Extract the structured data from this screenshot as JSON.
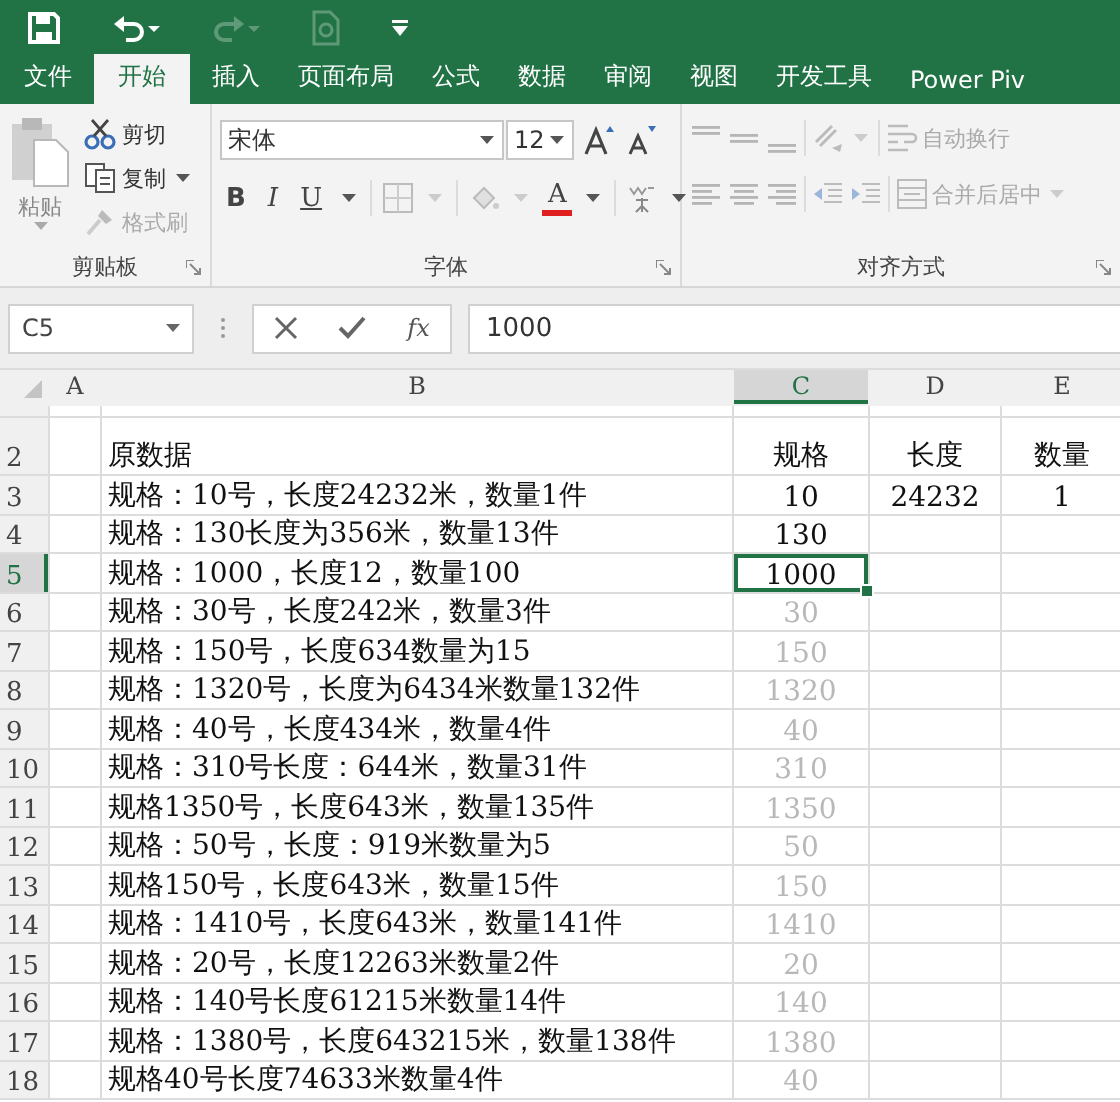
{
  "quick_access": [
    {
      "kind": "save",
      "disabled": false
    },
    {
      "kind": "undo",
      "disabled": false
    },
    {
      "kind": "redo",
      "disabled": true
    },
    {
      "kind": "preview",
      "disabled": true
    },
    {
      "kind": "customize",
      "disabled": false
    }
  ],
  "tabs": [
    {
      "label": "文件",
      "selected": false
    },
    {
      "label": "开始",
      "selected": true
    },
    {
      "label": "插入",
      "selected": false
    },
    {
      "label": "页面布局",
      "selected": false
    },
    {
      "label": "公式",
      "selected": false
    },
    {
      "label": "数据",
      "selected": false
    },
    {
      "label": "审阅",
      "selected": false
    },
    {
      "label": "视图",
      "selected": false
    },
    {
      "label": "开发工具",
      "selected": false
    },
    {
      "label": "Power Piv",
      "selected": false
    }
  ],
  "clipboard": {
    "label": "剪贴板",
    "paste": "粘贴",
    "cut": "剪切",
    "copy": "复制",
    "format_painter": {
      "label": "格式刷",
      "disabled": true
    }
  },
  "font": {
    "label": "字体",
    "font_name": "宋体",
    "font_size": "12",
    "bold": "B",
    "italic": "I",
    "underline": "U",
    "font_color": "A"
  },
  "alignment": {
    "label": "对齐方式",
    "wrap_text": {
      "label": "自动换行",
      "disabled": true
    },
    "merge": {
      "label": "合并后居中",
      "disabled": true
    }
  },
  "formula_bar": {
    "name_box": "C5",
    "function_label": "fx",
    "value": "1000"
  },
  "sheet": {
    "columns": [
      {
        "label": "A",
        "selected": false
      },
      {
        "label": "B",
        "selected": false
      },
      {
        "label": "C",
        "selected": true
      },
      {
        "label": "D",
        "selected": false
      },
      {
        "label": "E",
        "selected": false
      }
    ],
    "rows": [
      {
        "header": "2",
        "selected": false,
        "b": "原数据",
        "c": {
          "text": "规格",
          "preview": false,
          "active": false
        },
        "d": "长度",
        "e": "数量"
      },
      {
        "header": "3",
        "selected": false,
        "b": "规格：10号，长度24232米，数量1件",
        "c": {
          "text": "10",
          "preview": false,
          "active": false
        },
        "d": "24232",
        "e": "1"
      },
      {
        "header": "4",
        "selected": false,
        "b": "规格：130长度为356米，数量13件",
        "c": {
          "text": "130",
          "preview": false,
          "active": false
        }
      },
      {
        "header": "5",
        "selected": true,
        "b": "规格：1000，长度12，数量100",
        "c": {
          "text": "1000",
          "preview": false,
          "active": true
        }
      },
      {
        "header": "6",
        "selected": false,
        "b": "规格：30号，长度242米，数量3件",
        "c": {
          "text": "30",
          "preview": true,
          "active": false
        }
      },
      {
        "header": "7",
        "selected": false,
        "b": "规格：150号，长度634数量为15",
        "c": {
          "text": "150",
          "preview": true,
          "active": false
        }
      },
      {
        "header": "8",
        "selected": false,
        "b": "规格：1320号，长度为6434米数量132件",
        "c": {
          "text": "1320",
          "preview": true,
          "active": false
        }
      },
      {
        "header": "9",
        "selected": false,
        "b": "规格：40号，长度434米，数量4件",
        "c": {
          "text": "40",
          "preview": true,
          "active": false
        }
      },
      {
        "header": "10",
        "selected": false,
        "b": "规格：310号长度：644米，数量31件",
        "c": {
          "text": "310",
          "preview": true,
          "active": false
        }
      },
      {
        "header": "11",
        "selected": false,
        "b": "规格1350号，长度643米，数量135件",
        "c": {
          "text": "1350",
          "preview": true,
          "active": false
        }
      },
      {
        "header": "12",
        "selected": false,
        "b": "规格：50号，长度：919米数量为5",
        "c": {
          "text": "50",
          "preview": true,
          "active": false
        }
      },
      {
        "header": "13",
        "selected": false,
        "b": "规格150号，长度643米，数量15件",
        "c": {
          "text": "150",
          "preview": true,
          "active": false
        }
      },
      {
        "header": "14",
        "selected": false,
        "b": "规格：1410号，长度643米，数量141件",
        "c": {
          "text": "1410",
          "preview": true,
          "active": false
        }
      },
      {
        "header": "15",
        "selected": false,
        "b": "规格：20号，长度12263米数量2件",
        "c": {
          "text": "20",
          "preview": true,
          "active": false
        }
      },
      {
        "header": "16",
        "selected": false,
        "b": "规格：140号长度61215米数量14件",
        "c": {
          "text": "140",
          "preview": true,
          "active": false
        }
      },
      {
        "header": "17",
        "selected": false,
        "b": "规格：1380号，长度643215米，数量138件",
        "c": {
          "text": "1380",
          "preview": true,
          "active": false
        }
      },
      {
        "header": "18",
        "selected": false,
        "b": "规格40号长度74633米数量4件",
        "c": {
          "text": "40",
          "preview": true,
          "active": false
        }
      }
    ]
  }
}
